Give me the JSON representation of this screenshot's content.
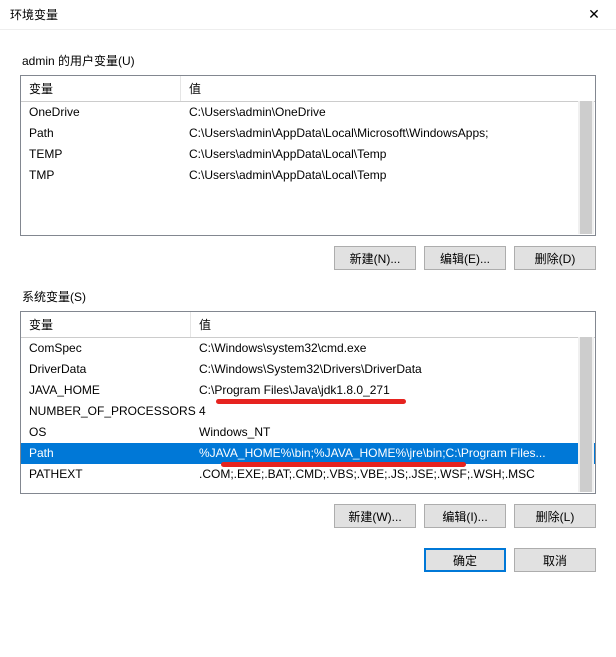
{
  "window": {
    "title": "环境变量",
    "close_glyph": "✕"
  },
  "user_section": {
    "label": "admin 的用户变量(U)",
    "col_name": "变量",
    "col_value": "值",
    "rows": [
      {
        "name": "OneDrive",
        "value": "C:\\Users\\admin\\OneDrive"
      },
      {
        "name": "Path",
        "value": "C:\\Users\\admin\\AppData\\Local\\Microsoft\\WindowsApps;"
      },
      {
        "name": "TEMP",
        "value": "C:\\Users\\admin\\AppData\\Local\\Temp"
      },
      {
        "name": "TMP",
        "value": "C:\\Users\\admin\\AppData\\Local\\Temp"
      }
    ],
    "buttons": {
      "new": "新建(N)...",
      "edit": "编辑(E)...",
      "delete": "删除(D)"
    }
  },
  "system_section": {
    "label": "系统变量(S)",
    "col_name": "变量",
    "col_value": "值",
    "rows": [
      {
        "name": "ComSpec",
        "value": "C:\\Windows\\system32\\cmd.exe"
      },
      {
        "name": "DriverData",
        "value": "C:\\Windows\\System32\\Drivers\\DriverData"
      },
      {
        "name": "JAVA_HOME",
        "value": "C:\\Program Files\\Java\\jdk1.8.0_271"
      },
      {
        "name": "NUMBER_OF_PROCESSORS",
        "value": "4"
      },
      {
        "name": "OS",
        "value": "Windows_NT"
      },
      {
        "name": "Path",
        "value": "%JAVA_HOME%\\bin;%JAVA_HOME%\\jre\\bin;C:\\Program Files..."
      },
      {
        "name": "PATHEXT",
        "value": ".COM;.EXE;.BAT;.CMD;.VBS;.VBE;.JS;.JSE;.WSF;.WSH;.MSC"
      }
    ],
    "selected_index": 5,
    "buttons": {
      "new": "新建(W)...",
      "edit": "编辑(I)...",
      "delete": "删除(L)"
    }
  },
  "dialog_buttons": {
    "ok": "确定",
    "cancel": "取消"
  },
  "annotations": {
    "underline_java_home": true,
    "underline_path": true
  }
}
